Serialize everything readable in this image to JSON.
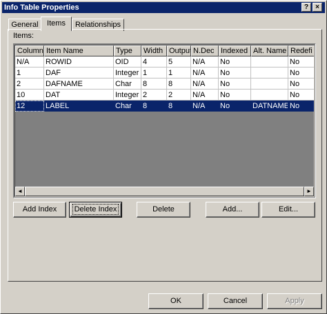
{
  "window": {
    "title": "Info Table Properties",
    "help_label": "?",
    "close_label": "×"
  },
  "tabs": [
    {
      "label": "General"
    },
    {
      "label": "Items"
    },
    {
      "label": "Relationships"
    }
  ],
  "items_label": "Items:",
  "table": {
    "columns": [
      "Column",
      "Item Name",
      "Type",
      "Width",
      "Output",
      "N.Dec",
      "Indexed",
      "Alt. Name",
      "Redefi"
    ],
    "rows": [
      [
        "N/A",
        "ROWID",
        "OID",
        "4",
        "5",
        "N/A",
        "No",
        "",
        "No"
      ],
      [
        "1",
        "DAF",
        "Integer",
        "1",
        "1",
        "N/A",
        "No",
        "",
        "No"
      ],
      [
        "2",
        "DAFNAME",
        "Char",
        "8",
        "8",
        "N/A",
        "No",
        "",
        "No"
      ],
      [
        "10",
        "DAT",
        "Integer",
        "2",
        "2",
        "N/A",
        "No",
        "",
        "No"
      ],
      [
        "12",
        "LABEL",
        "Char",
        "8",
        "8",
        "N/A",
        "No",
        "DATNAME",
        "No"
      ]
    ],
    "selected_row": 4
  },
  "scrollbar": {
    "left_arrow": "◄",
    "right_arrow": "►"
  },
  "item_buttons": {
    "add_index": "Add Index",
    "delete_index": "Delete Index",
    "delete": "Delete",
    "add": "Add...",
    "edit": "Edit..."
  },
  "dialog_buttons": {
    "ok": "OK",
    "cancel": "Cancel",
    "apply": "Apply"
  }
}
